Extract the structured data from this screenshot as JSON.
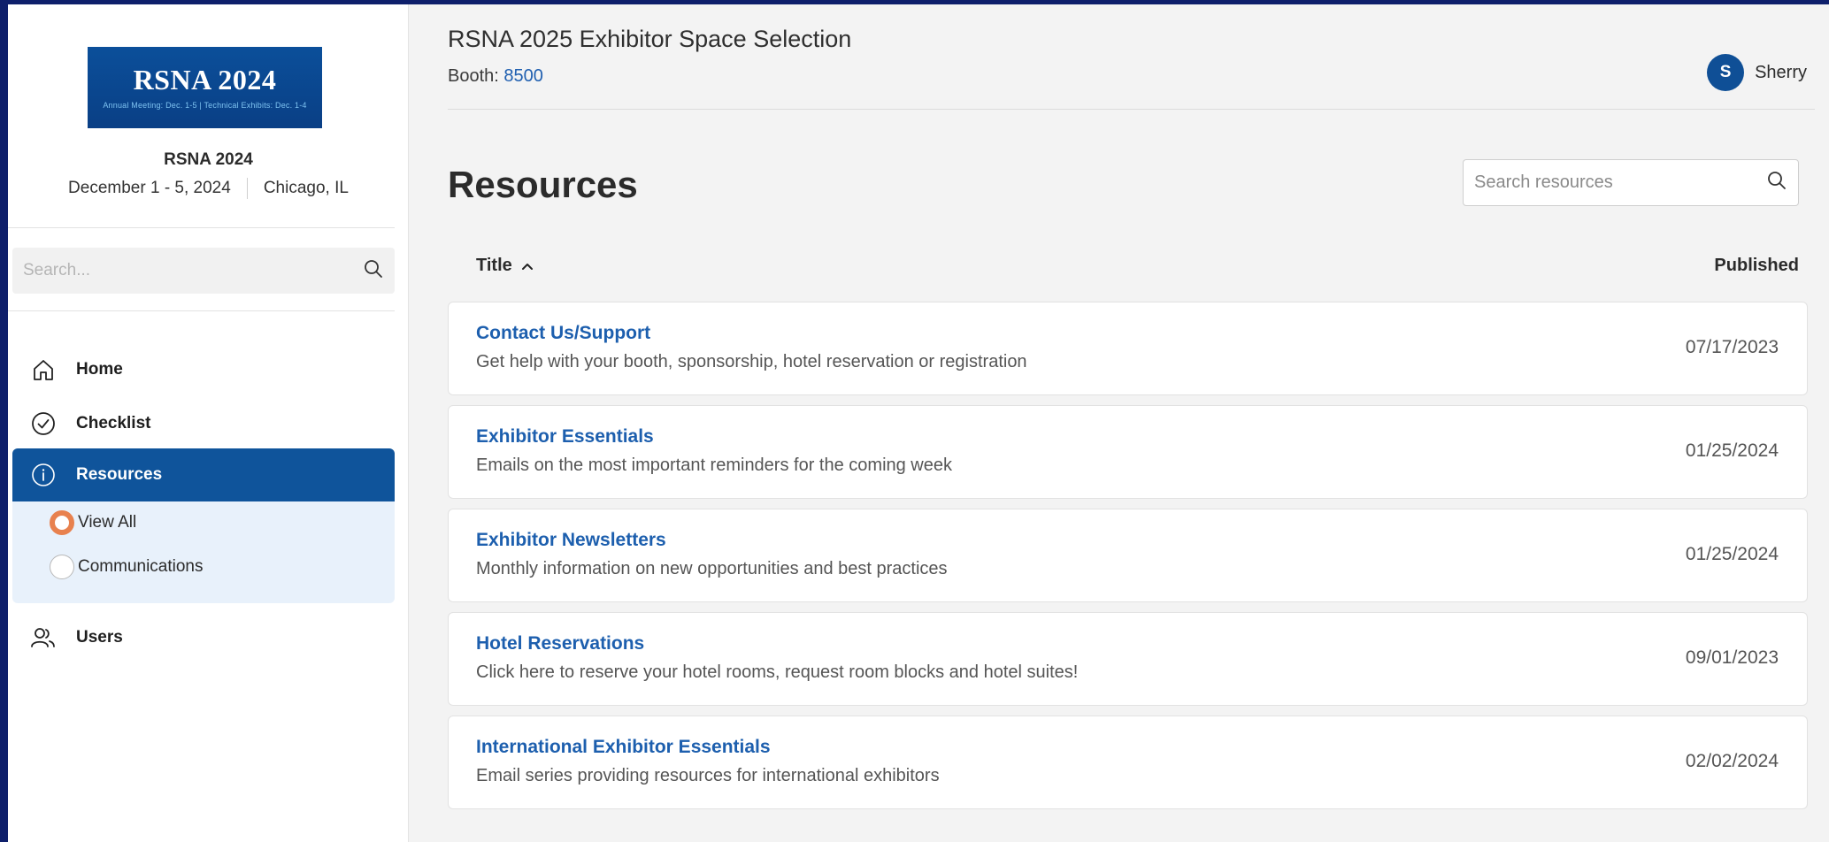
{
  "logo": {
    "title": "RSNA 2024",
    "subtitle": "Annual Meeting: Dec. 1-5 | Technical Exhibits: Dec. 1-4"
  },
  "event": {
    "name": "RSNA 2024",
    "dates": "December 1 - 5, 2024",
    "location": "Chicago, IL"
  },
  "sidebar": {
    "search_placeholder": "Search...",
    "nav": [
      {
        "label": "Home",
        "icon": "home-icon"
      },
      {
        "label": "Checklist",
        "icon": "check-circle-icon"
      },
      {
        "label": "Resources",
        "icon": "info-icon",
        "active": true
      },
      {
        "label": "Users",
        "icon": "users-icon"
      }
    ],
    "sub": [
      {
        "label": "View All",
        "selected": true
      },
      {
        "label": "Communications",
        "selected": false
      }
    ]
  },
  "header": {
    "title": "RSNA 2025 Exhibitor Space Selection",
    "booth_label": "Booth:",
    "booth_number": "8500",
    "user_initial": "S",
    "user_name": "Sherry"
  },
  "resources": {
    "title": "Resources",
    "search_placeholder": "Search resources",
    "col_title": "Title",
    "col_published": "Published",
    "rows": [
      {
        "title": "Contact Us/Support",
        "desc": "Get help with your booth, sponsorship, hotel reservation or registration",
        "date": "07/17/2023"
      },
      {
        "title": "Exhibitor Essentials",
        "desc": "Emails on the most important reminders for the coming week",
        "date": "01/25/2024"
      },
      {
        "title": "Exhibitor Newsletters",
        "desc": "Monthly information on new opportunities and best practices",
        "date": "01/25/2024"
      },
      {
        "title": "Hotel Reservations",
        "desc": "Click here to reserve your hotel rooms, request room blocks and hotel suites!",
        "date": "09/01/2023"
      },
      {
        "title": "International Exhibitor Essentials",
        "desc": "Email series providing resources for international exhibitors",
        "date": "02/02/2024"
      }
    ]
  },
  "colors": {
    "primary": "#0f549b",
    "link": "#1d5fae",
    "radio_selected": "#e8814e",
    "page_bg": "#f3f3f3"
  }
}
